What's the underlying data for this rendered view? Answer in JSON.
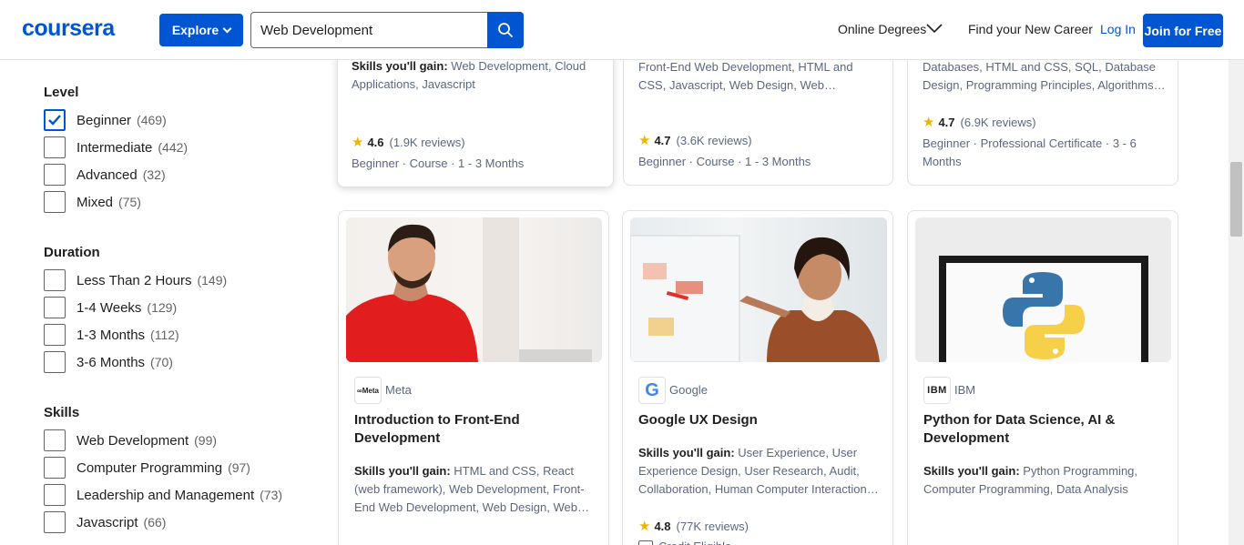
{
  "header": {
    "logo": "coursera",
    "explore_label": "Explore",
    "search_value": "Web Development",
    "nav": {
      "online_degrees": "Online Degrees",
      "find_career": "Find your New Career",
      "login": "Log In",
      "join": "Join for Free"
    }
  },
  "filters": {
    "level": {
      "title": "Level",
      "options": [
        {
          "label": "Beginner",
          "count": "(469)",
          "checked": true
        },
        {
          "label": "Intermediate",
          "count": "(442)",
          "checked": false
        },
        {
          "label": "Advanced",
          "count": "(32)",
          "checked": false
        },
        {
          "label": "Mixed",
          "count": "(75)",
          "checked": false
        }
      ]
    },
    "duration": {
      "title": "Duration",
      "options": [
        {
          "label": "Less Than 2 Hours",
          "count": "(149)"
        },
        {
          "label": "1-4 Weeks",
          "count": "(129)"
        },
        {
          "label": "1-3 Months",
          "count": "(112)"
        },
        {
          "label": "3-6 Months",
          "count": "(70)"
        }
      ]
    },
    "skills": {
      "title": "Skills",
      "options": [
        {
          "label": "Web Development",
          "count": "(99)"
        },
        {
          "label": "Computer Programming",
          "count": "(97)"
        },
        {
          "label": "Leadership and Management",
          "count": "(73)"
        },
        {
          "label": "Javascript",
          "count": "(66)"
        }
      ]
    }
  },
  "top_cards": [
    {
      "skills_label": "Skills you'll gain:",
      "skills": "Web Development, Cloud Applications, Javascript",
      "rating": "4.6",
      "reviews": "(1.9K reviews)",
      "meta": "Beginner · Course · 1 - 3 Months"
    },
    {
      "skills": "Front-End Web Development, HTML and CSS, Javascript, Web Design, Web Development, Front-End Development",
      "rating": "4.7",
      "reviews": "(3.6K reviews)",
      "meta": "Beginner · Course · 1 - 3 Months"
    },
    {
      "skills": "Databases, HTML and CSS, SQL, Database Design, Programming Principles, Algorithms, Data Structures",
      "rating": "4.7",
      "reviews": "(6.9K reviews)",
      "meta": "Beginner · Professional Certificate · 3 - 6 Months"
    }
  ],
  "cards": [
    {
      "partner": "Meta",
      "title": "Introduction to Front-End Development",
      "skills_label": "Skills you'll gain:",
      "skills": "HTML and CSS, React (web framework), Web Development, Front-End Web Development, Web Design, Web Development Tools"
    },
    {
      "partner": "Google",
      "title": "Google UX Design",
      "skills_label": "Skills you'll gain:",
      "skills": "User Experience, User Experience Design, User Research, Audit, Collaboration, Human Computer Interaction, Wireframe",
      "rating": "4.8",
      "reviews": "(77K reviews)",
      "extra": "Credit Eligible"
    },
    {
      "partner": "IBM",
      "title": "Python for Data Science, AI & Development",
      "skills_label": "Skills you'll gain:",
      "skills": "Python Programming, Computer Programming, Data Analysis"
    }
  ],
  "colors": {
    "brand": "#0056d2",
    "star": "#f0b400",
    "muted": "#5b6780"
  }
}
